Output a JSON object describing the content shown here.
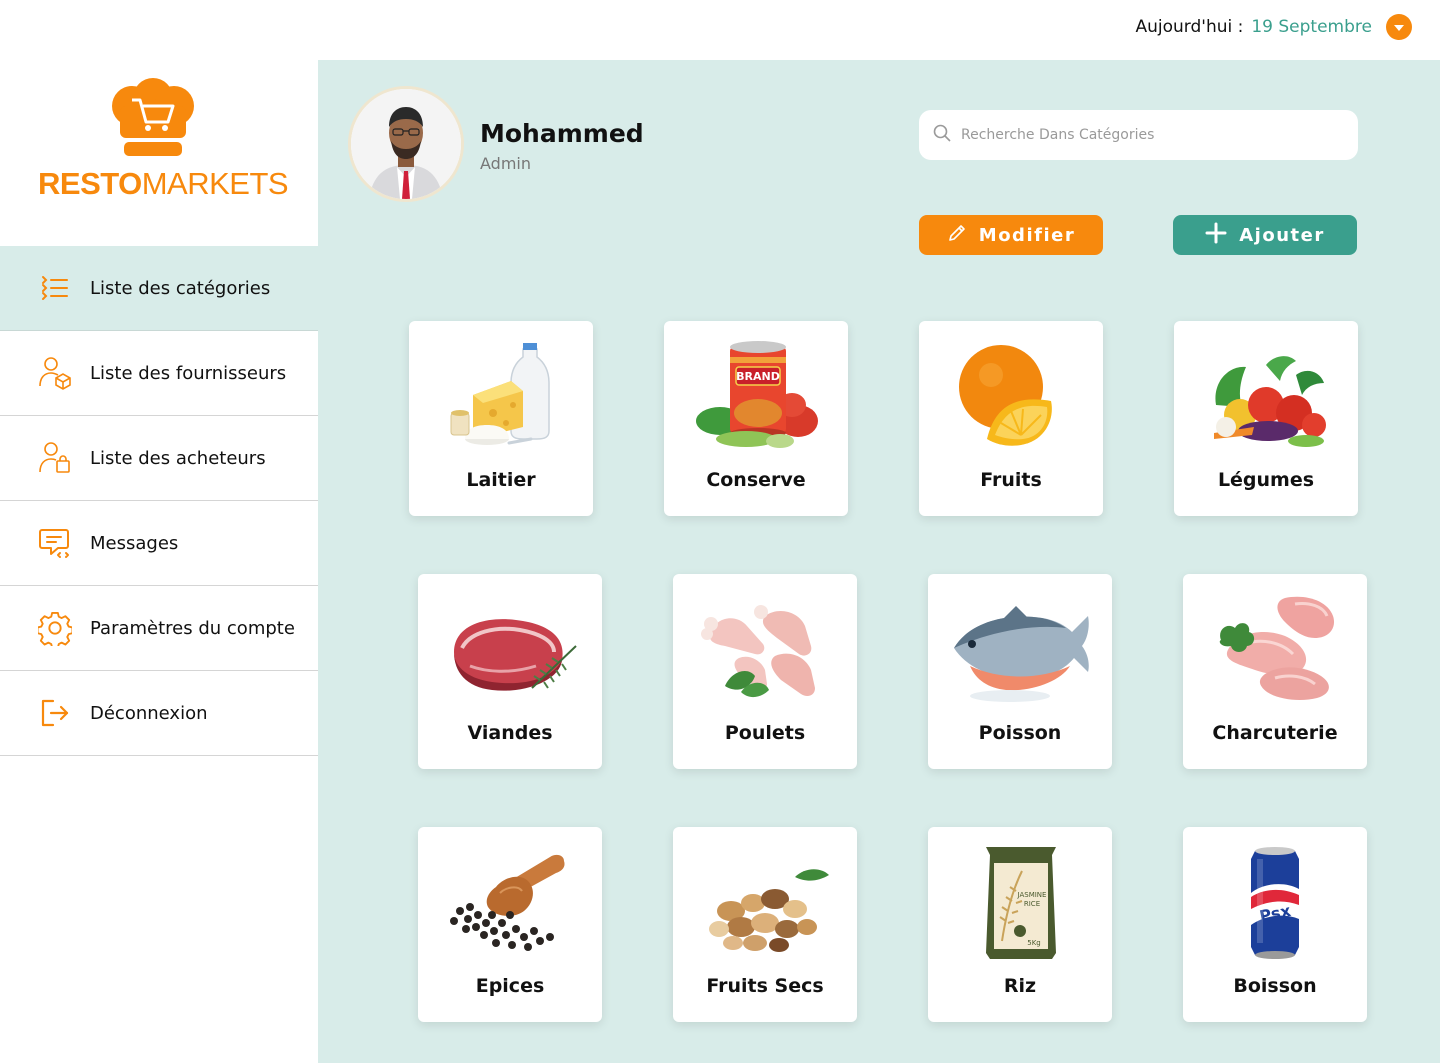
{
  "header": {
    "date_label": "Aujourd'hui :",
    "date_value": "19 Septembre"
  },
  "brand": {
    "part1": "RESTO",
    "part2": "MARKETS",
    "color": "#f7890d"
  },
  "colors": {
    "accent_orange": "#f7890d",
    "accent_green": "#3a9f8d",
    "panel_bg": "#d8ece9"
  },
  "sidebar": {
    "items": [
      {
        "label": "Liste des catégories",
        "icon": "list-icon",
        "active": true
      },
      {
        "label": "Liste des fournisseurs",
        "icon": "supplier-icon",
        "active": false
      },
      {
        "label": "Liste des acheteurs",
        "icon": "buyer-icon",
        "active": false
      },
      {
        "label": "Messages",
        "icon": "message-icon",
        "active": false
      },
      {
        "label": "Paramètres du compte",
        "icon": "gear-icon",
        "active": false
      },
      {
        "label": "Déconnexion",
        "icon": "logout-icon",
        "active": false
      }
    ]
  },
  "profile": {
    "name": "Mohammed",
    "role": "Admin"
  },
  "search": {
    "placeholder": "Recherche Dans Catégories"
  },
  "actions": {
    "modify_label": "Modifier",
    "add_label": "Ajouter"
  },
  "categories": [
    {
      "label": "Laitier",
      "icon": "dairy-icon"
    },
    {
      "label": "Conserve",
      "icon": "canned-food-icon"
    },
    {
      "label": "Fruits",
      "icon": "orange-icon"
    },
    {
      "label": "Légumes",
      "icon": "vegetables-icon"
    },
    {
      "label": "Viandes",
      "icon": "meat-icon"
    },
    {
      "label": "Poulets",
      "icon": "chicken-icon"
    },
    {
      "label": "Poisson",
      "icon": "fish-icon"
    },
    {
      "label": "Charcuterie",
      "icon": "ham-icon"
    },
    {
      "label": "Epices",
      "icon": "spices-icon"
    },
    {
      "label": "Fruits Secs",
      "icon": "nuts-icon"
    },
    {
      "label": "Riz",
      "icon": "rice-bag-icon"
    },
    {
      "label": "Boisson",
      "icon": "soda-can-icon"
    }
  ]
}
